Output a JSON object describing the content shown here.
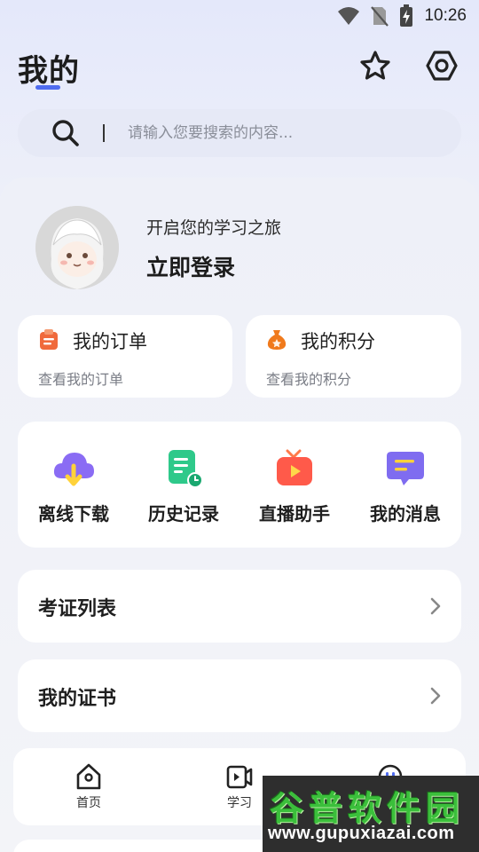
{
  "status_bar": {
    "time": "10:26",
    "icons": [
      "wifi-icon",
      "no-sim-icon",
      "battery-charging-icon"
    ]
  },
  "header": {
    "title": "我的",
    "actions": [
      "star-icon",
      "settings-icon"
    ],
    "accent_color": "#4f6cf0"
  },
  "search": {
    "placeholder": "请输入您要搜索的内容...",
    "value": ""
  },
  "profile": {
    "subtitle": "开启您的学习之旅",
    "login_label": "立即登录"
  },
  "quick_cards": [
    {
      "title": "我的订单",
      "subtitle": "查看我的订单",
      "icon": "clipboard-icon",
      "icon_color": "#f06a3c"
    },
    {
      "title": "我的积分",
      "subtitle": "查看我的积分",
      "icon": "coin-bag-icon",
      "icon_color": "#f07a1c"
    }
  ],
  "tools": [
    {
      "label": "离线下载",
      "icon": "cloud-download-icon",
      "color": "#8a6cf4"
    },
    {
      "label": "历史记录",
      "icon": "history-doc-icon",
      "color": "#2ec98a"
    },
    {
      "label": "直播助手",
      "icon": "live-tv-icon",
      "color": "#ff5a4a"
    },
    {
      "label": "我的消息",
      "icon": "message-icon",
      "color": "#7f6cf0"
    }
  ],
  "list_items": [
    {
      "label": "考证列表"
    },
    {
      "label": "我的证书"
    }
  ],
  "bottom_nav": [
    {
      "label": "首页",
      "icon": "home-icon"
    },
    {
      "label": "学习",
      "icon": "video-learn-icon"
    },
    {
      "label": "",
      "icon": "profile-icon"
    }
  ],
  "watermark": {
    "top": "谷普软件园",
    "bottom": "www.gupuxiazai.com"
  }
}
